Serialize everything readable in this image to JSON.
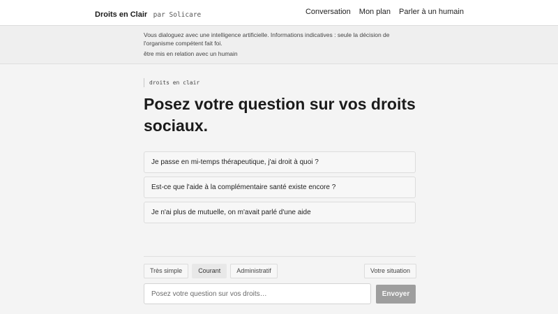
{
  "header": {
    "brand_name": "Droits en Clair",
    "brand_sub": "par Solicare",
    "nav": [
      "Conversation",
      "Mon plan",
      "Parler à un humain"
    ]
  },
  "notice": {
    "text": "Vous dialoguez avec une intelligence artificielle. Informations indicatives : seule la décision de l'organisme compétent fait foi.",
    "link": "être mis en relation avec un humain"
  },
  "main": {
    "tag": "droits en clair",
    "title": "Posez votre question sur vos droits sociaux.",
    "suggestions": [
      "Je passe en mi-temps thérapeutique, j'ai droit à quoi ?",
      "Est-ce que l'aide à la complémentaire santé existe encore ?",
      "Je n'ai plus de mutuelle, on m'avait parlé d'une aide"
    ]
  },
  "composer": {
    "levels": [
      "Très simple",
      "Courant",
      "Administratif"
    ],
    "active_level": "Courant",
    "situation_label": "Votre situation",
    "input_placeholder": "Posez votre question sur vos droits…",
    "input_value": "",
    "send_label": "Envoyer"
  },
  "colors": {
    "page_background": "#f4f4f4",
    "header_background": "#ffffff",
    "send_button": "#9e9e9e",
    "active_level": "#e8e8e8"
  }
}
